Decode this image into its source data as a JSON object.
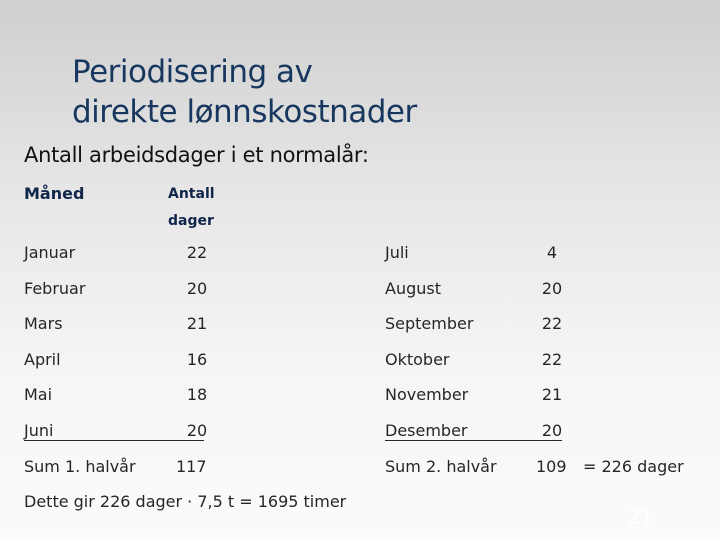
{
  "title_line1": "Periodisering av",
  "title_line2": "direkte lønnskostnader",
  "subtitle": "Antall arbeidsdager i et normalår:",
  "headers": {
    "month": "Måned",
    "days_line1": "Antall",
    "days_line2": "dager"
  },
  "left_rows": [
    {
      "month": "Januar",
      "days": "22"
    },
    {
      "month": "Februar",
      "days": "20"
    },
    {
      "month": "Mars",
      "days": "21"
    },
    {
      "month": "April",
      "days": "16"
    },
    {
      "month": "Mai",
      "days": "18"
    },
    {
      "month": "Juni",
      "days": "20"
    }
  ],
  "right_rows": [
    {
      "month": "Juli",
      "days": "4"
    },
    {
      "month": "August",
      "days": "20"
    },
    {
      "month": "September",
      "days": "22"
    },
    {
      "month": "Oktober",
      "days": "22"
    },
    {
      "month": "November",
      "days": "21"
    },
    {
      "month": "Desember",
      "days": "20"
    }
  ],
  "sum1": {
    "label": "Sum 1. halvår",
    "value": "117"
  },
  "sum2": {
    "label": "Sum 2. halvår",
    "value": "109",
    "total": "=  226 dager"
  },
  "footer": "Dette gir 226 dager · 7,5 t = 1695 timer",
  "slide_number": "21",
  "colors": {
    "title": "#17375e",
    "header": "#10254a",
    "text": "#262626"
  }
}
